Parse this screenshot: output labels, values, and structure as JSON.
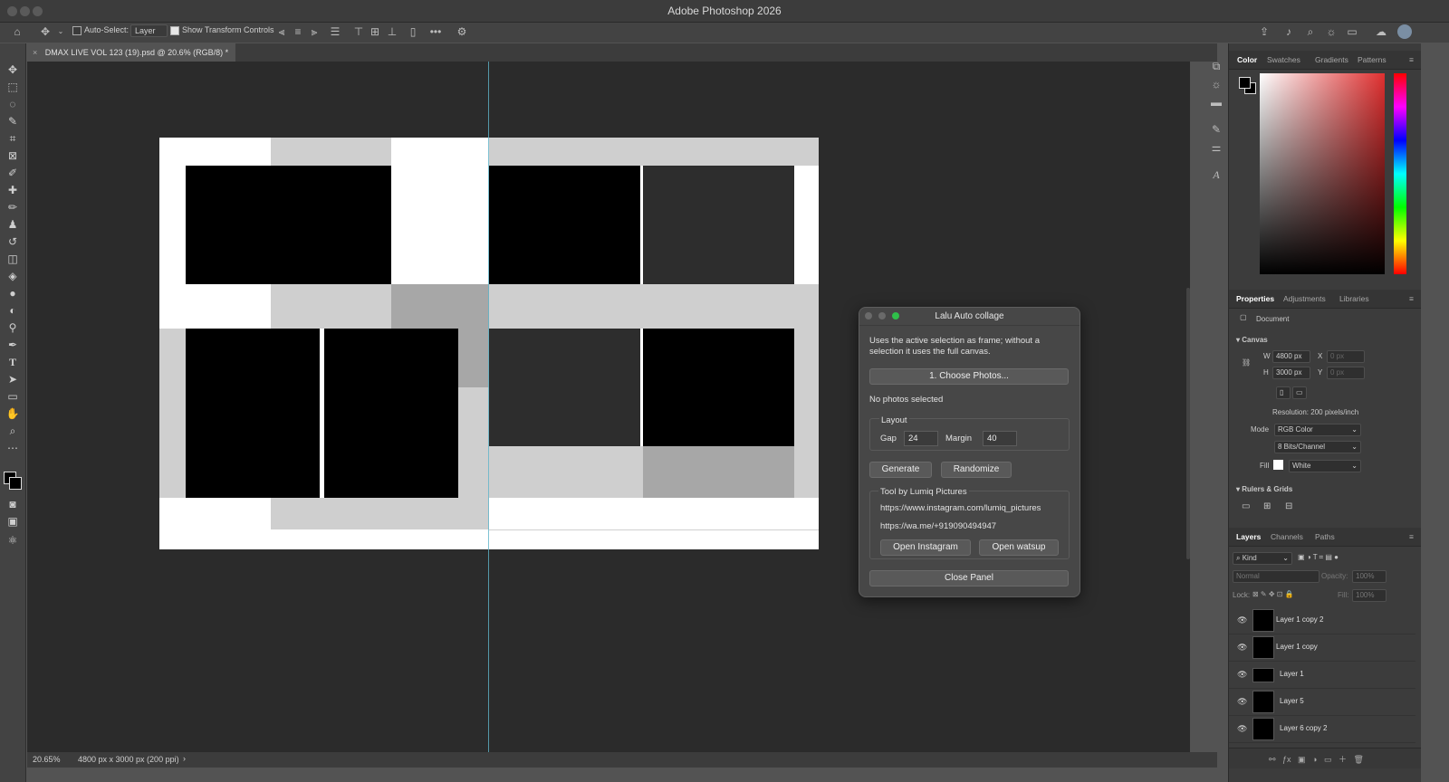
{
  "app": {
    "title": "Adobe Photoshop 2026"
  },
  "options": {
    "auto_select_label": "Auto-Select:",
    "auto_select_value": "Layer",
    "transform_label": "Show Transform Controls"
  },
  "document": {
    "tab_title": "DMAX LIVE VOL 123 (19).psd @ 20.6% (RGB/8) *",
    "zoom": "20.65%",
    "info": "4800 px x 3000 px (200 ppi)"
  },
  "color_panel": {
    "tabs": [
      "Color",
      "Swatches",
      "Gradients",
      "Patterns"
    ],
    "foreground": "#000000",
    "background": "#ffffff"
  },
  "properties": {
    "tabs": [
      "Properties",
      "Adjustments",
      "Libraries"
    ],
    "kind": "Document",
    "canvas_label": "Canvas",
    "w_label": "W",
    "w_value": "4800 px",
    "h_label": "H",
    "h_value": "3000 px",
    "x_label": "X",
    "x_value": "0 px",
    "y_label": "Y",
    "y_value": "0 px",
    "resolution": "Resolution: 200 pixels/inch",
    "mode_label": "Mode",
    "mode_value": "RGB Color",
    "depth_value": "8 Bits/Channel",
    "fill_label": "Fill",
    "fill_value": "White",
    "rulers_label": "Rulers & Grids"
  },
  "layers_panel": {
    "tabs": [
      "Layers",
      "Channels",
      "Paths"
    ],
    "kind_filter": "Kind",
    "blend_mode": "Normal",
    "opacity_label": "Opacity:",
    "opacity_value": "100%",
    "lock_label": "Lock:",
    "fill_label": "Fill:",
    "fill_value": "100%",
    "layers": [
      "Layer 1 copy 2",
      "Layer 1 copy",
      "Layer 1",
      "Layer 5",
      "Layer 6 copy 2"
    ]
  },
  "dialog": {
    "title": "Lalu Auto collage",
    "description": "Uses the active selection as frame; without a selection it uses the full canvas.",
    "choose_button": "1. Choose Photos...",
    "status": "No photos selected",
    "layout_label": "Layout",
    "gap_label": "Gap",
    "gap_value": "24",
    "margin_label": "Margin",
    "margin_value": "40",
    "generate_button": "Generate",
    "randomize_button": "Randomize",
    "credit_label": "Tool by Lumiq Pictures",
    "instagram_url": "https://www.instagram.com/lumiq_pictures",
    "whatsapp_url": "https://wa.me/+919090494947",
    "open_instagram_button": "Open Instagram",
    "open_watsup_button": "Open watsup",
    "close_button": "Close Panel"
  }
}
